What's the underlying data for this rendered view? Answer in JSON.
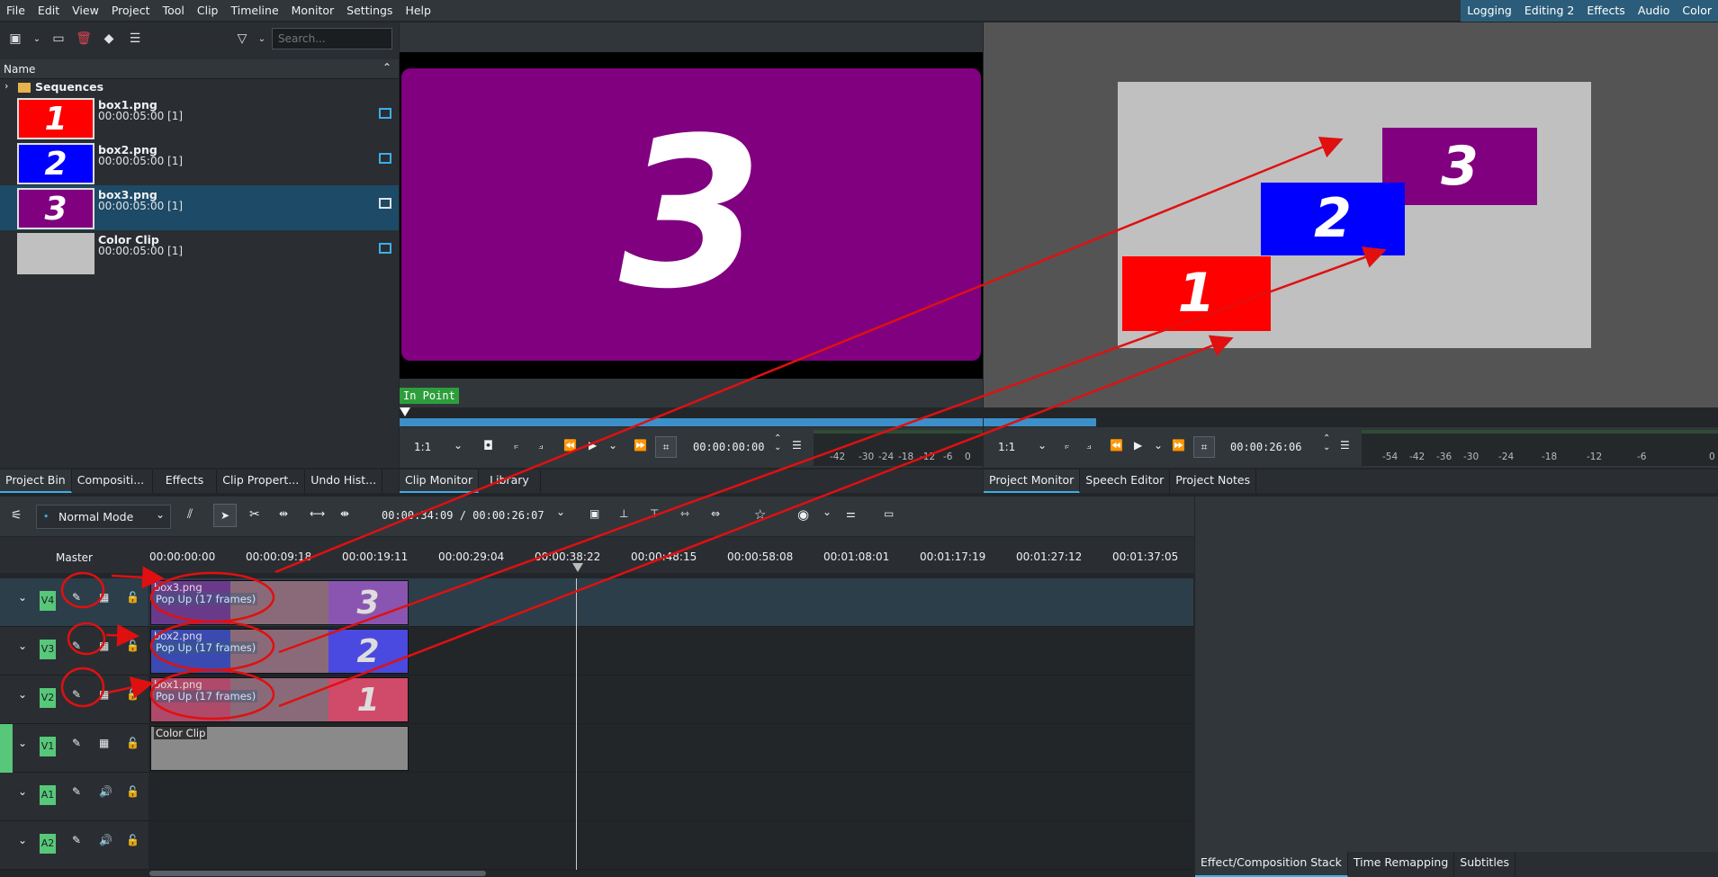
{
  "menu": [
    "File",
    "Edit",
    "View",
    "Project",
    "Tool",
    "Clip",
    "Timeline",
    "Monitor",
    "Settings",
    "Help"
  ],
  "layouts": [
    "Logging",
    "Editing 2",
    "Effects",
    "Audio",
    "Color"
  ],
  "bin": {
    "search_placeholder": "Search...",
    "header_name": "Name",
    "folder": "Sequences",
    "items": [
      {
        "name": "box1.png",
        "duration": "00:00:05:00 [1]",
        "thumb_text": "1",
        "color": "#ff0000"
      },
      {
        "name": "box2.png",
        "duration": "00:00:05:00 [1]",
        "thumb_text": "2",
        "color": "#0000ff"
      },
      {
        "name": "box3.png",
        "duration": "00:00:05:00 [1]",
        "thumb_text": "3",
        "color": "#800080"
      },
      {
        "name": "Color Clip",
        "duration": "00:00:05:00 [1]",
        "thumb_text": "",
        "color": "#c0c0c0"
      }
    ]
  },
  "left_tabs": [
    "Project Bin",
    "Compositi...",
    "Effects",
    "Clip Propert...",
    "Undo Hist..."
  ],
  "clip_monitor": {
    "big_text": "3",
    "in_point": "In Point",
    "zoom": "1:1",
    "timecode": "00:00:00:00",
    "vu": [
      "-42",
      "-30",
      "-24",
      "-18",
      "-12",
      "-6",
      "0"
    ],
    "tabs": [
      "Clip Monitor",
      "Library"
    ]
  },
  "project_monitor": {
    "boxes": [
      "3",
      "2",
      "1"
    ],
    "zoom": "1:1",
    "timecode": "00:00:26:06",
    "vu": [
      "-54",
      "-42",
      "-36",
      "-30",
      "-24",
      "-18",
      "-12",
      "-6",
      "0"
    ],
    "tabs": [
      "Project Monitor",
      "Speech Editor",
      "Project Notes"
    ]
  },
  "timeline": {
    "mode": "Normal Mode",
    "position": "00:00:34:09 / 00:00:26:07",
    "master": "Master",
    "ruler": [
      "00:00:00:00",
      "00:00:09:18",
      "00:00:19:11",
      "00:00:29:04",
      "00:00:38:22",
      "00:00:48:15",
      "00:00:58:08",
      "00:01:08:01",
      "00:01:17:19",
      "00:01:27:12",
      "00:01:37:05"
    ],
    "tracks": [
      {
        "tag": "V4",
        "clip": "box3.png",
        "fx": "Pop Up (17 frames)",
        "num": "3"
      },
      {
        "tag": "V3",
        "clip": "box2.png",
        "fx": "Pop Up (17 frames)",
        "num": "2"
      },
      {
        "tag": "V2",
        "clip": "box1.png",
        "fx": "Pop Up (17 frames)",
        "num": "1"
      },
      {
        "tag": "V1",
        "clip": "Color Clip",
        "fx": "",
        "num": ""
      },
      {
        "tag": "A1",
        "clip": "",
        "fx": "",
        "num": ""
      },
      {
        "tag": "A2",
        "clip": "",
        "fx": "",
        "num": ""
      }
    ]
  },
  "right_tabs": [
    "Effect/Composition Stack",
    "Time Remapping",
    "Subtitles"
  ],
  "colors": {
    "accent": "#3daee9",
    "track_tag": "#57c77a",
    "annotation": "#e01010"
  }
}
